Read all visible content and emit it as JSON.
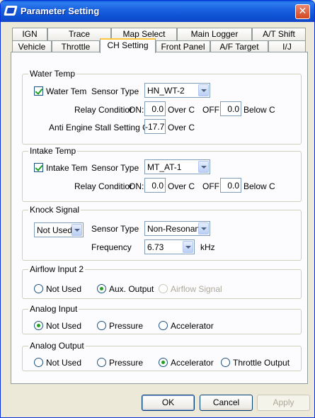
{
  "window": {
    "title": "Parameter Setting",
    "close_glyph": "✕"
  },
  "tabs_row1": [
    "IGN",
    "Trace",
    "Map Select",
    "Main Logger",
    "A/T Shift"
  ],
  "tabs_row2": [
    "Vehicle",
    "Throttle",
    "CH Setting",
    "Front Panel",
    "A/F Target",
    "I/J"
  ],
  "active_tab": "CH Setting",
  "water_temp": {
    "group_title": "Water Temp",
    "checkbox_label": "Water Tem",
    "checked": true,
    "sensor_type_label": "Sensor Type",
    "sensor_type_value": "HN_WT-2",
    "relay_label": "Relay Conditior",
    "on_label": "ON:",
    "on_value": "0.0",
    "over_c": "Over C",
    "off_label": "OFF:",
    "off_value": "0.0",
    "below_c": "Below C",
    "anti_label": "Anti Engine Stall Setting ON",
    "anti_value": "-17.7",
    "anti_over_c": "Over C"
  },
  "intake_temp": {
    "group_title": "Intake Temp",
    "checkbox_label": "Intake Tem",
    "checked": true,
    "sensor_type_label": "Sensor Type",
    "sensor_type_value": "MT_AT-1",
    "relay_label": "Relay Conditior",
    "on_label": "ON:",
    "on_value": "0.0",
    "over_c": "Over C",
    "off_label": "OFF:",
    "off_value": "0.0",
    "below_c": "Below C"
  },
  "knock_signal": {
    "group_title": "Knock Signal",
    "mode_value": "Not Used",
    "sensor_type_label": "Sensor Type",
    "sensor_type_value": "Non-Resonant",
    "frequency_label": "Frequency",
    "frequency_value": "6.73",
    "frequency_unit": "kHz"
  },
  "airflow_input2": {
    "group_title": "Airflow Input 2",
    "options": [
      "Not Used",
      "Aux. Output",
      "Airflow Signal"
    ],
    "selected": "Aux. Output",
    "disabled": [
      "Airflow Signal"
    ]
  },
  "analog_input": {
    "group_title": "Analog Input",
    "options": [
      "Not Used",
      "Pressure",
      "Accelerator"
    ],
    "selected": "Not Used"
  },
  "analog_output": {
    "group_title": "Analog Output",
    "options": [
      "Not Used",
      "Pressure",
      "Accelerator",
      "Throttle Output"
    ],
    "selected": "Accelerator"
  },
  "buttons": {
    "ok": "OK",
    "cancel": "Cancel",
    "apply": "Apply"
  },
  "colors": {
    "titlebar": "#0C4FD2",
    "face": "#ECE9D8",
    "panel": "#FCFCFE",
    "check_green": "#21A121"
  }
}
